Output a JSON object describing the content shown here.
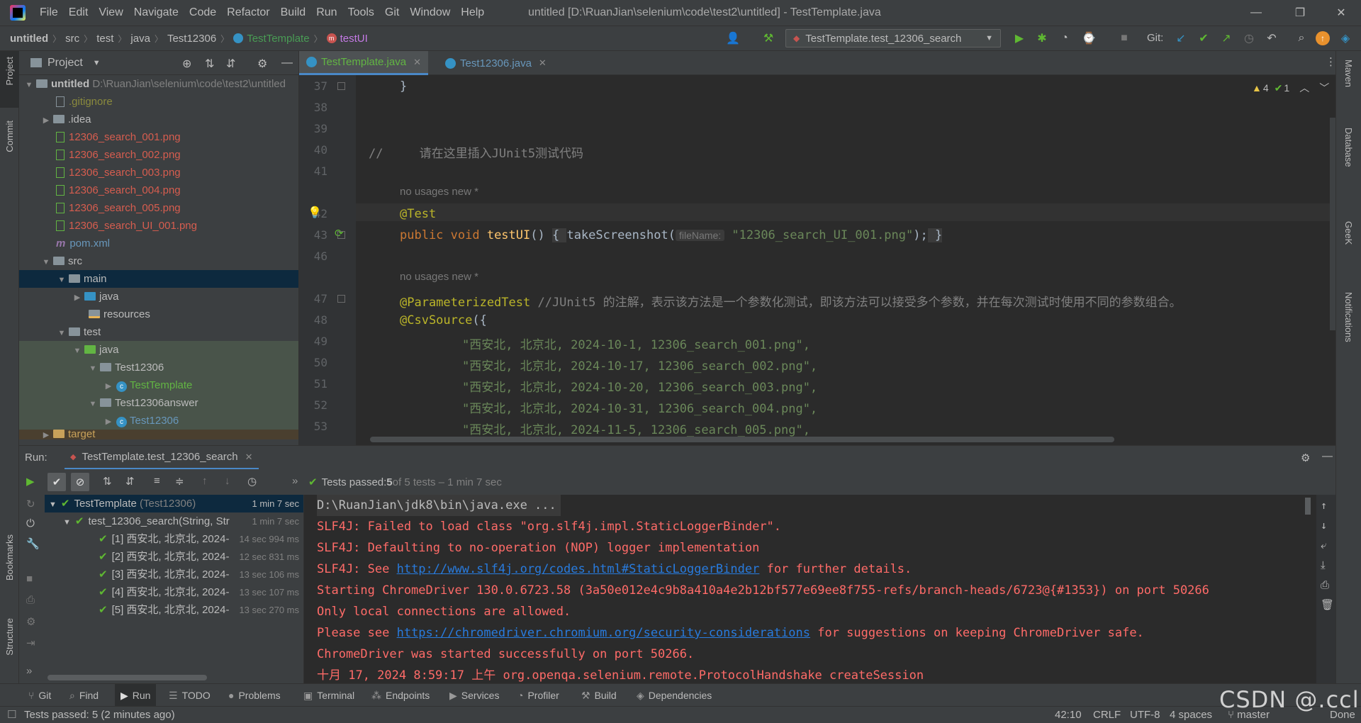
{
  "menu": [
    "File",
    "Edit",
    "View",
    "Navigate",
    "Code",
    "Refactor",
    "Build",
    "Run",
    "Tools",
    "Git",
    "Window",
    "Help"
  ],
  "window_title": "untitled [D:\\RuanJian\\selenium\\code\\test2\\untitled] - TestTemplate.java",
  "breadcrumb": [
    "untitled",
    "src",
    "test",
    "java",
    "Test12306",
    "TestTemplate",
    "testUI"
  ],
  "run_config": "TestTemplate.test_12306_search",
  "git_label": "Git:",
  "project": {
    "title": "Project",
    "root_name": "untitled",
    "root_path": "D:\\RuanJian\\selenium\\code\\test2\\untitled",
    "items": [
      ".gitignore",
      ".idea",
      "12306_search_001.png",
      "12306_search_002.png",
      "12306_search_003.png",
      "12306_search_004.png",
      "12306_search_005.png",
      "12306_search_UI_001.png",
      "pom.xml",
      "src",
      "main",
      "java",
      "resources",
      "test",
      "java",
      "Test12306",
      "TestTemplate",
      "Test12306answer",
      "Test12306",
      "target"
    ]
  },
  "tabs": [
    "TestTemplate.java",
    "Test12306.java"
  ],
  "inspections": {
    "warnings": "4",
    "checks": "1"
  },
  "editor": {
    "line_numbers": [
      "37",
      "38",
      "39",
      "40",
      "41",
      "42",
      "43",
      "46",
      "47",
      "48",
      "49",
      "50",
      "51",
      "52",
      "53"
    ],
    "brace": "}",
    "comment40": "//     请在这里插入JUnit5测试代码",
    "hint1": "no usages   new *",
    "annot42": "@Test",
    "l43_kw": "public void ",
    "l43_fn": "testUI",
    "l43_a": "() ",
    "l43_b": "{ ",
    "l43_c": "takeScreenshot(",
    "l43_param": "fileName:",
    "l43_str": "\"12306_search_UI_001.png\"",
    "l43_d": ");",
    "l43_e": " }",
    "hint2": "no usages   new *",
    "annot47": "@ParameterizedTest",
    "comment47": " //JUnit5 的注解，表示该方法是一个参数化测试，即该方法可以接受多个参数，并在每次测试时使用不同的参数组合。",
    "annot48": "@CsvSource",
    "l48_rest": "({",
    "csv": [
      "\"西安北, 北京北, 2024-10-1, 12306_search_001.png\",",
      "\"西安北, 北京北, 2024-10-17, 12306_search_002.png\",",
      "\"西安北, 北京北, 2024-10-20, 12306_search_003.png\",",
      "\"西安北, 北京北, 2024-10-31, 12306_search_004.png\",",
      "\"西安北, 北京北, 2024-11-5, 12306_search_005.png\","
    ]
  },
  "run": {
    "label": "Run:",
    "tab": "TestTemplate.test_12306_search",
    "status_prefix": "Tests passed: ",
    "status_count": "5",
    "status_suffix": " of 5 tests – 1 min 7 sec",
    "tree": [
      {
        "name": "TestTemplate",
        "sub": " (Test12306)",
        "time": "1 min 7 sec"
      },
      {
        "name": "test_12306_search(String, Str",
        "sub": "",
        "time": "1 min 7 sec"
      },
      {
        "name": "[1] 西安北, 北京北, 2024-",
        "sub": "",
        "time": "14 sec 994 ms"
      },
      {
        "name": "[2] 西安北, 北京北, 2024-",
        "sub": "",
        "time": "12 sec 831 ms"
      },
      {
        "name": "[3] 西安北, 北京北, 2024-",
        "sub": "",
        "time": "13 sec 106 ms"
      },
      {
        "name": "[4] 西安北, 北京北, 2024-",
        "sub": "",
        "time": "13 sec 107 ms"
      },
      {
        "name": "[5] 西安北, 北京北, 2024-",
        "sub": "",
        "time": "13 sec 270 ms"
      }
    ],
    "console": {
      "l1": "D:\\RuanJian\\jdk8\\bin\\java.exe ...",
      "l2": "SLF4J: Failed to load class \"org.slf4j.impl.StaticLoggerBinder\".",
      "l3": "SLF4J: Defaulting to no-operation (NOP) logger implementation",
      "l4a": "SLF4J: See ",
      "l4link": "http://www.slf4j.org/codes.html#StaticLoggerBinder",
      "l4b": " for further details.",
      "l5": "Starting ChromeDriver 130.0.6723.58 (3a50e012e4c9b8a410a4e2b12bf577e69ee8f755-refs/branch-heads/6723@{#1353}) on port 50266",
      "l6": "Only local connections are allowed.",
      "l7a": "Please see ",
      "l7link": "https://chromedriver.chromium.org/security-considerations",
      "l7b": " for suggestions on keeping ChromeDriver safe.",
      "l8": "ChromeDriver was started successfully on port 50266.",
      "l9": "十月 17, 2024 8:59:17 上午 org.openqa.selenium.remote.ProtocolHandshake createSession"
    }
  },
  "left_strip": [
    "Project",
    "Commit",
    "Bookmarks",
    "Structure"
  ],
  "right_strip": [
    "Maven",
    "Database",
    "GeeK",
    "Notifications"
  ],
  "bottom_tools": [
    "Git",
    "Find",
    "Run",
    "TODO",
    "Problems",
    "Terminal",
    "Endpoints",
    "Services",
    "Profiler",
    "Build",
    "Dependencies"
  ],
  "status": {
    "message": "Tests passed: 5 (2 minutes ago)",
    "position": "42:10",
    "line_sep": "CRLF",
    "encoding": "UTF-8",
    "indent": "4 spaces",
    "branch": "master",
    "done": "Done"
  },
  "watermark": "CSDN @.ccl",
  "colors": {
    "accent": "#4a88c7",
    "pass": "#5fb832",
    "error_text": "#ff6b68",
    "link": "#287bde"
  }
}
